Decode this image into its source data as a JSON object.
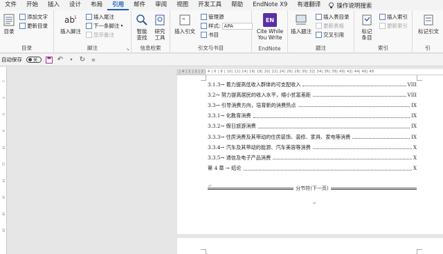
{
  "menubar": {
    "items": [
      "文件",
      "开始",
      "插入",
      "设计",
      "布局",
      "引用",
      "邮件",
      "审阅",
      "视图",
      "开发工具",
      "帮助",
      "EndNote X9",
      "有道翻译"
    ],
    "active_index": 5,
    "search_label": "操作说明搜索"
  },
  "ribbon": {
    "toc_group": {
      "label": "目录",
      "toc_button": "目录",
      "add_text": "添加文字",
      "update_toc": "更新目录"
    },
    "footnote_group": {
      "label": "脚注",
      "insert_footnote": "插入脚注",
      "insert_endnote": "插入尾注",
      "next_footnote": "下一条脚注",
      "show_notes": "显示备注"
    },
    "info_group": {
      "label": "信息检索",
      "smart_lookup": "智能查找",
      "researcher": "研究工具"
    },
    "citation_group": {
      "label": "引文与书目",
      "insert_citation": "插入引文",
      "manage_sources": "管理源",
      "style_label": "样式:",
      "style_value": "APA",
      "bibliography": "书目"
    },
    "endnote_group": {
      "label": "EndNote",
      "cite_while": "Cite While You Write",
      "badge": "EN"
    },
    "caption_group": {
      "label": "题注",
      "insert_caption": "插入题注",
      "insert_table_figures": "插入表目录",
      "update_table": "更新表格",
      "cross_reference": "交叉引用"
    },
    "index_group": {
      "label": "索引",
      "mark_entry": "标记条目",
      "insert_index": "插入索引",
      "update_index": "更新索引"
    },
    "citations_group": {
      "label": "引",
      "mark_citation": "标记引文"
    }
  },
  "qat": {
    "autosave": "自动保存",
    "toggle": "关"
  },
  "ruler": {
    "h_text": "| 4 |  1 |  2 | 2 |  4 |  6 |  8 | 10|  12|  14|  16|  18|  20|  22|  24|  26|  28|  30|  32|  34|  36|  38|  40|  42|  44| 46|  48",
    "v_ticks": [
      "2",
      "4",
      "6",
      "8",
      "10",
      "12",
      "14",
      "16",
      "18",
      "20"
    ]
  },
  "toc": [
    {
      "text": "3.1.3→ 着力提高低收入群体的可支配收入",
      "page": "VIII"
    },
    {
      "text": "3.2→ 努力提高居民的收入水平，缩小贫富差距",
      "page": "VIII"
    },
    {
      "text": "3.3→ 引导消费方向，培育新的消费热点",
      "page": "IX"
    },
    {
      "text": "3.3.1→ 化教育消费",
      "page": "IX"
    },
    {
      "text": "3.3.2→ 假日旅游消费",
      "page": "IX"
    },
    {
      "text": "3.3.3→ 住房消费及其带动的住房装饰、装修、家具、家电等消费",
      "page": "IX"
    },
    {
      "text": "3.3.4→ 汽车及其带动的能源、汽车美容等消费",
      "page": "X"
    },
    {
      "text": "3.3.5→ 通信及电子产品消费",
      "page": "X"
    },
    {
      "text": "第 4 章 → 结论",
      "page": "X"
    }
  ],
  "section_break": "分节符(下一页)",
  "tab_mark": "→",
  "para_mark": "↵",
  "colors": {
    "accent": "#185abd",
    "endnote_red": "#c00000",
    "endnote_badge": "#5b2fa8"
  }
}
